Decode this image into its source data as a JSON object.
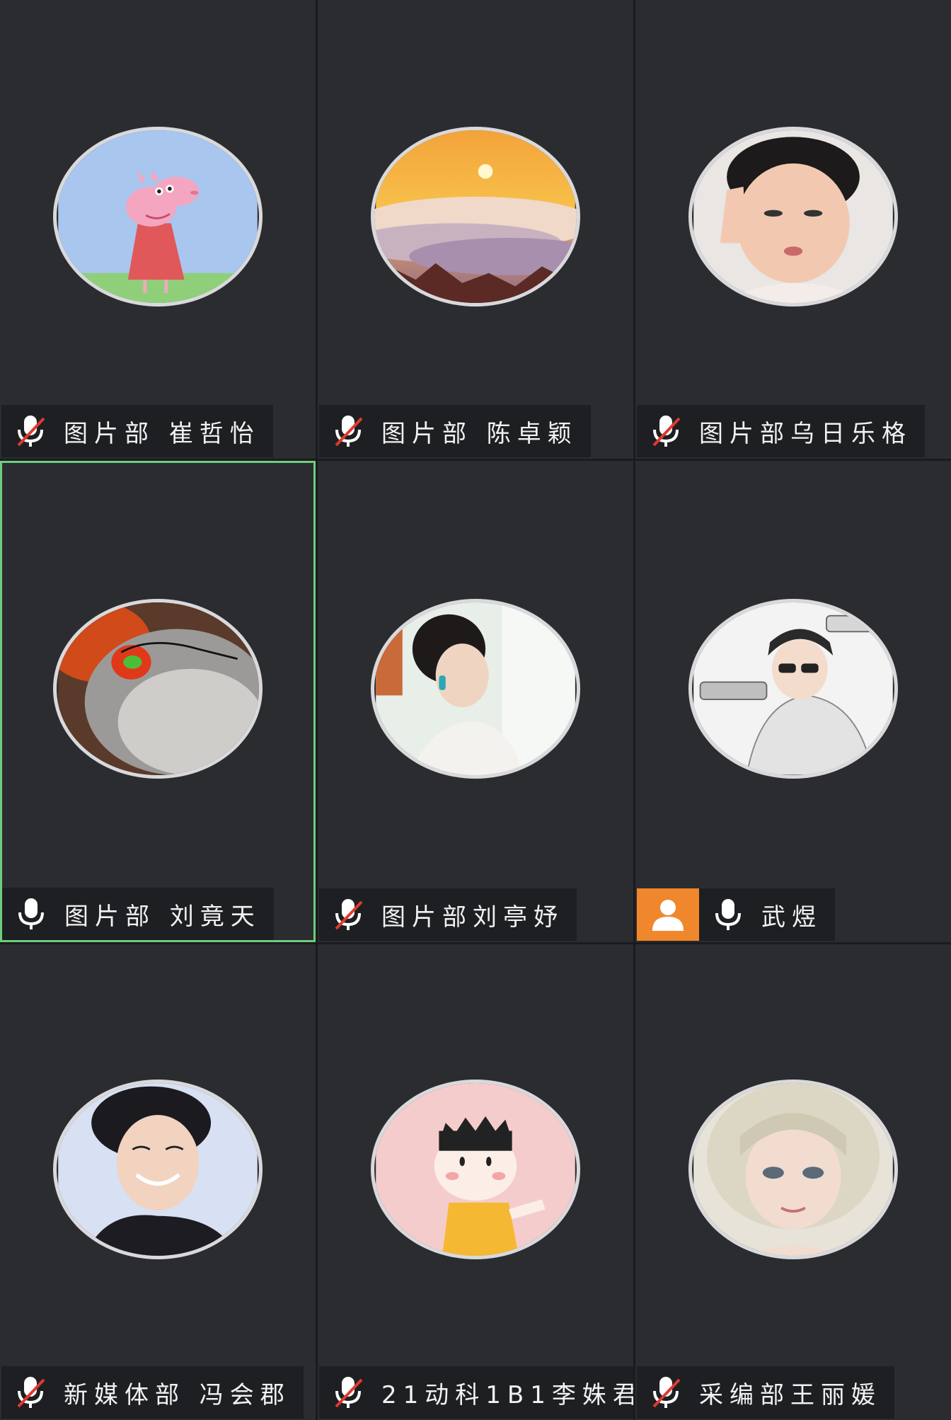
{
  "participants": [
    {
      "name": "图片部 崔哲怡",
      "mic": "muted",
      "avatar": "peppa-pig"
    },
    {
      "name": "图片部 陈卓颖",
      "mic": "muted",
      "avatar": "sunset-clouds"
    },
    {
      "name": "图片部乌日乐格",
      "mic": "muted",
      "avatar": "child-salute"
    },
    {
      "name": "图片部 刘竟天",
      "mic": "on",
      "avatar": "satellite-storm",
      "active": true
    },
    {
      "name": "图片部刘亭妤",
      "mic": "muted",
      "avatar": "woman-window"
    },
    {
      "name": "武煜",
      "mic": "on",
      "avatar": "cartoon-photographer",
      "no_video_badge": true
    },
    {
      "name": "新媒体部 冯会郡",
      "mic": "muted",
      "avatar": "young-man-smiling"
    },
    {
      "name": "21动科1B1李姝君",
      "mic": "muted",
      "avatar": "cartoon-girl"
    },
    {
      "name": "采编部王丽媛",
      "mic": "muted",
      "avatar": "blonde-girl-art"
    }
  ],
  "colors": {
    "tile_bg": "#2b2c30",
    "label_bg": "#1e1f22",
    "active_border": "#6ccf7c",
    "mute_slash": "#e0392f",
    "badge_orange": "#f0872c"
  }
}
